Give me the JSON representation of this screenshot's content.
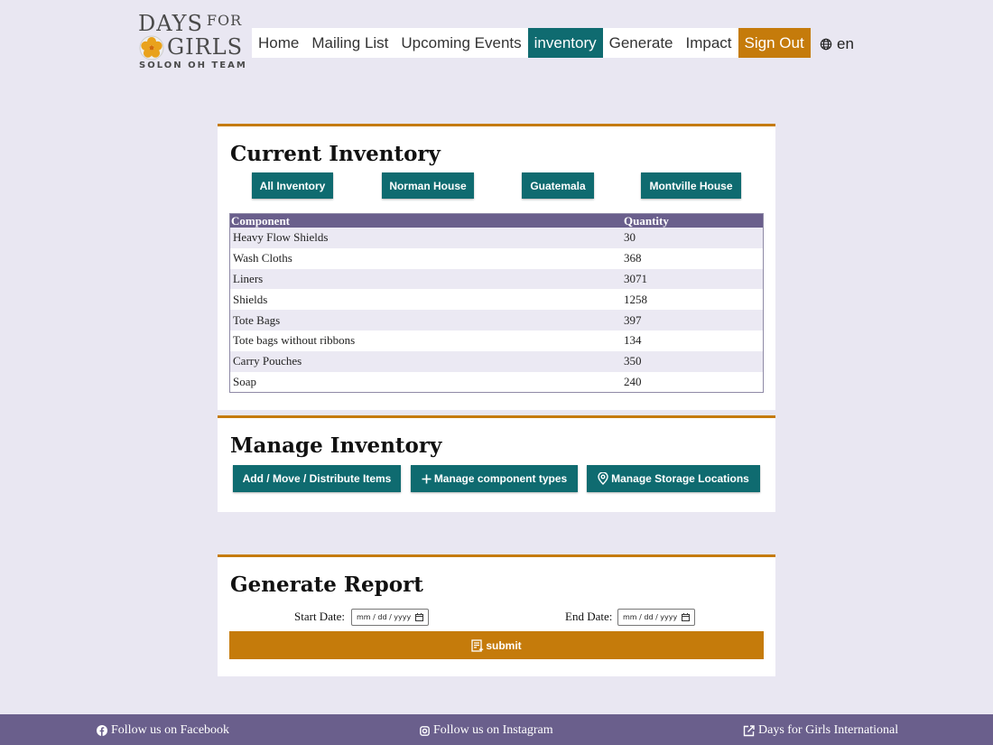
{
  "logo": {
    "line1": "DAYS",
    "line1_small": "FOR",
    "line2": "GIRLS",
    "line3": "SOLON OH TEAM"
  },
  "nav": {
    "items": [
      "Home",
      "Mailing List",
      "Upcoming Events",
      "inventory",
      "Generate",
      "Impact",
      "Sign Out"
    ],
    "active": "inventory",
    "language": "en"
  },
  "current_inventory": {
    "title": "Current Inventory",
    "location_buttons": [
      "All Inventory",
      "Norman House",
      "Guatemala",
      "Montville House"
    ],
    "table": {
      "headers": [
        "Component",
        "Quantity"
      ],
      "rows": [
        [
          "Heavy Flow Shields",
          "30"
        ],
        [
          "Wash Cloths",
          "368"
        ],
        [
          "Liners",
          "3071"
        ],
        [
          "Shields",
          "1258"
        ],
        [
          "Tote Bags",
          "397"
        ],
        [
          "Tote bags without ribbons",
          "134"
        ],
        [
          "Carry Pouches",
          "350"
        ],
        [
          "Soap",
          "240"
        ]
      ]
    }
  },
  "manage_inventory": {
    "title": "Manage Inventory",
    "buttons": [
      "Add / Move / Distribute Items",
      "Manage component types",
      "Manage Storage Locations"
    ]
  },
  "generate_report": {
    "title": "Generate Report",
    "start_label": "Start Date:",
    "end_label": "End Date:",
    "date_placeholder": "mm / dd / yyyy",
    "submit_label": "submit"
  },
  "footer": {
    "facebook": "Follow us on Facebook",
    "instagram": "Follow us on Instagram",
    "international": "Days for Girls International"
  },
  "colors": {
    "teal": "#0f6b70",
    "orange": "#c57b0b",
    "purple": "#6a5f8c",
    "background": "#e9e7f2"
  }
}
